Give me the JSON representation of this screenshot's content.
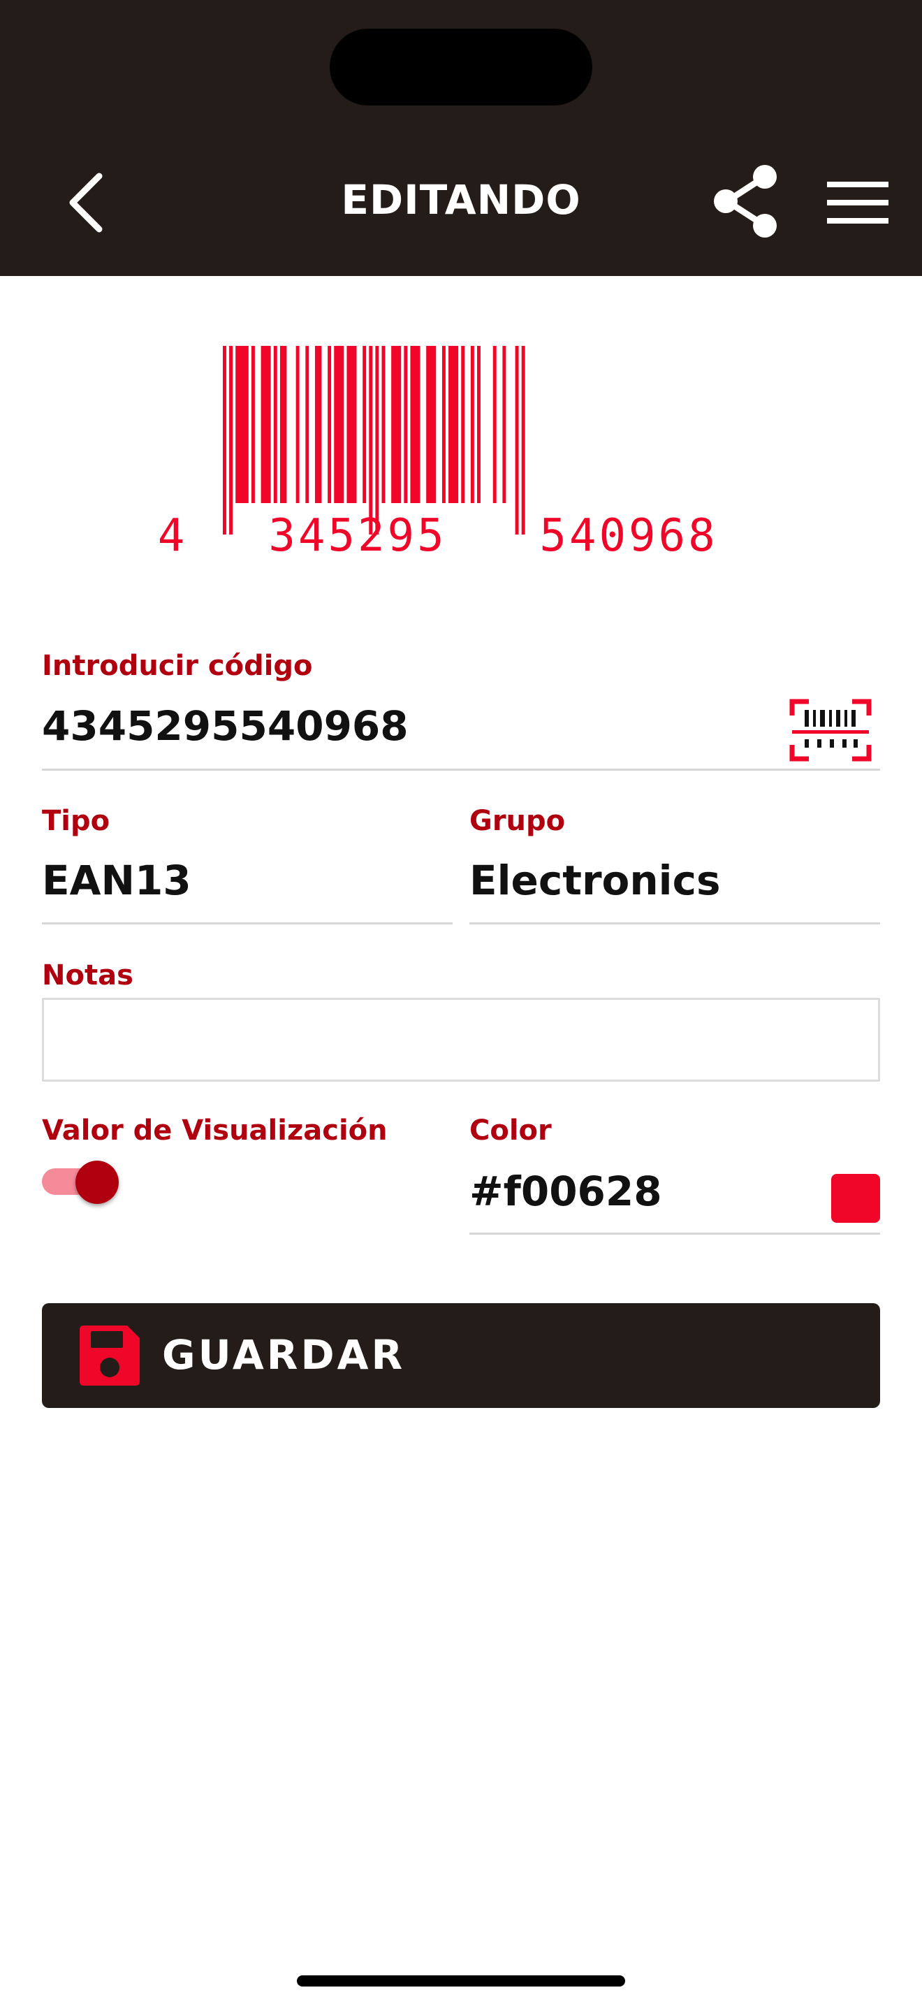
{
  "header": {
    "title": "EDITANDO",
    "back_icon": "chevron-left-icon",
    "share_icon": "share-icon",
    "menu_icon": "hamburger-menu-icon",
    "background_color": "#241c18"
  },
  "barcode": {
    "digits": "4345295540968",
    "group_first": "4",
    "group_left": "345295",
    "group_right": "540968",
    "color": "#f00628"
  },
  "form": {
    "code": {
      "label": "Introducir código",
      "value": "4345295540968",
      "scan_icon": "barcode-scan-icon"
    },
    "type": {
      "label": "Tipo",
      "value": "EAN13"
    },
    "group": {
      "label": "Grupo",
      "value": "Electronics"
    },
    "notes": {
      "label": "Notas",
      "value": ""
    },
    "display_value": {
      "label": "Valor de Visualización",
      "enabled": true
    },
    "color": {
      "label": "Color",
      "value": "#f00628",
      "swatch": "#f00628"
    }
  },
  "save_button": {
    "label": "GUARDAR",
    "icon": "floppy-disk-icon"
  },
  "colors": {
    "accent": "#b00010",
    "brand_red": "#f00628",
    "dark": "#241c18"
  }
}
